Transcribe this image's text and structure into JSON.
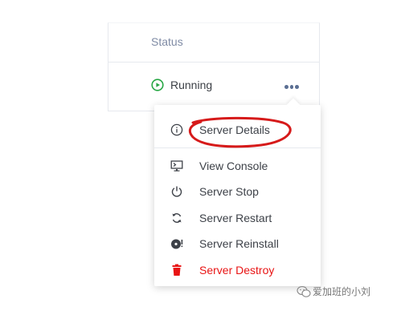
{
  "table": {
    "status_header": "Status",
    "row": {
      "status": "Running"
    }
  },
  "menu": {
    "items": [
      {
        "label": "Server Details",
        "icon": "info-icon"
      },
      {
        "label": "View Console",
        "icon": "monitor-icon"
      },
      {
        "label": "Server Stop",
        "icon": "power-icon"
      },
      {
        "label": "Server Restart",
        "icon": "refresh-icon"
      },
      {
        "label": "Server Reinstall",
        "icon": "disk-icon"
      },
      {
        "label": "Server Destroy",
        "icon": "trash-icon",
        "color": "#e81414"
      }
    ]
  },
  "annotation": {
    "color": "#d61a1a"
  },
  "watermark": {
    "text": "爱加班的小刘"
  },
  "colors": {
    "running": "#28a745",
    "header_text": "#7f8ba5",
    "danger": "#e81414"
  }
}
